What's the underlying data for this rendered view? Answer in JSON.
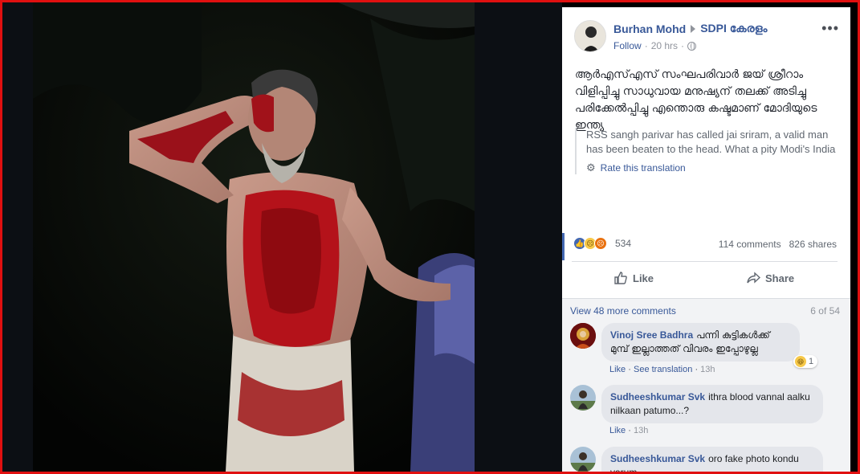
{
  "post": {
    "author": "Burhan Mohd",
    "page": "SDPI കേരളം",
    "follow": "Follow",
    "time": "20 hrs",
    "more_icon": "more-horizontal-icon",
    "text": "ആർഎസ്എസ് സംഘപരിവാർ ജയ് ശ്രീറാം വിളിപ്പിച്ചു സാധുവായ മനുഷ്യന് തലക്ക് അടിച്ചു പരിക്കേൽപ്പിച്ചു എന്തൊരു കഷ്ടമാണ് മോദിയുടെ ഇന്ത്യ",
    "translation": "RSS sangh parivar has called jai sriram, a valid man has been beaten to the head. What a pity Modi's India",
    "rate_translation": "Rate this translation"
  },
  "reactions": {
    "icons": [
      "like-icon",
      "sad-icon",
      "angry-icon"
    ],
    "count": "534",
    "comments": "114 comments",
    "shares": "826 shares"
  },
  "actions": {
    "like": "Like",
    "share": "Share"
  },
  "comments": {
    "view_more": "View 48 more comments",
    "pager": "6 of 54",
    "items": [
      {
        "name": "Vinoj Sree Badhra",
        "text": "പന്നി കുട്ടികൾക്ക് മുമ്പ് ഇല്ലാത്തത് വിവരം ഇപ്പോഴുല്ല",
        "like": "Like",
        "see_translation": "See translation",
        "time": "13h",
        "reaction_count": "1"
      },
      {
        "name": "Sudheeshkumar Svk",
        "text": "ithra blood vannal aalku nilkaan patumo...?",
        "like": "Like",
        "time": "13h"
      },
      {
        "name": "Sudheeshkumar Svk",
        "text": "oro fake photo kondu varum"
      }
    ]
  },
  "colors": {
    "link": "#385898",
    "frame": "#e01010",
    "viewer_bg": "#0c0f14"
  }
}
